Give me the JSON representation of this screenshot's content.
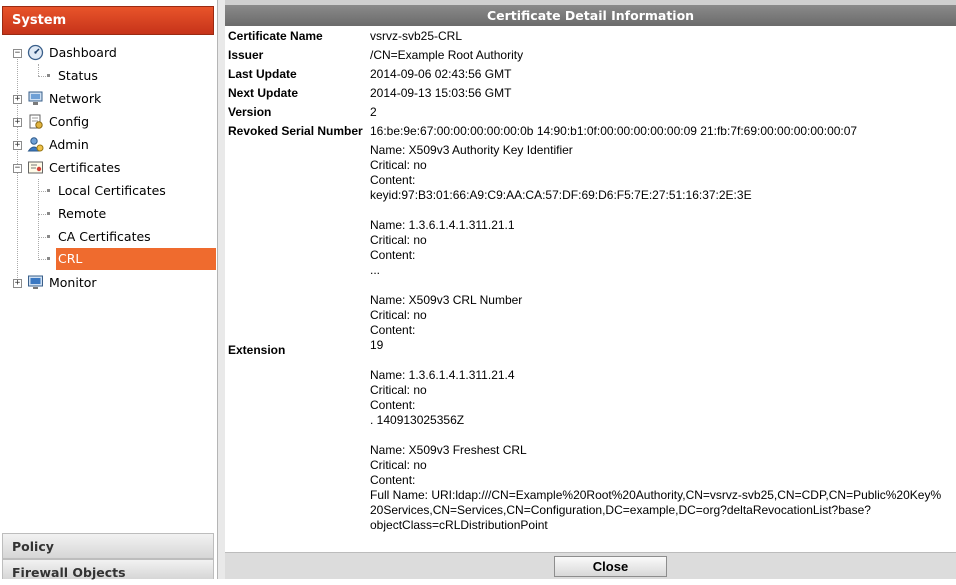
{
  "sidebar": {
    "header": "System",
    "tree": [
      {
        "label": "Dashboard",
        "icon": "dashboard-icon",
        "expanded": true
      },
      {
        "label": "Status",
        "icon": "",
        "leaf": true
      },
      {
        "label": "Network",
        "icon": "network-icon",
        "expanded": false
      },
      {
        "label": "Config",
        "icon": "config-icon",
        "expanded": false
      },
      {
        "label": "Admin",
        "icon": "admin-icon",
        "expanded": false
      },
      {
        "label": "Certificates",
        "icon": "certificates-icon",
        "expanded": true
      },
      {
        "label": "Local Certificates",
        "leaf": true
      },
      {
        "label": "Remote",
        "leaf": true
      },
      {
        "label": "CA Certificates",
        "leaf": true
      },
      {
        "label": "CRL",
        "leaf": true,
        "selected": true
      },
      {
        "label": "Monitor",
        "icon": "monitor-icon",
        "expanded": false
      }
    ],
    "bottom_sections": [
      "Policy",
      "Firewall Objects"
    ]
  },
  "panel": {
    "title": "Certificate Detail Information",
    "fields": {
      "certificate_name": {
        "label": "Certificate Name",
        "value": "vsrvz-svb25-CRL"
      },
      "issuer": {
        "label": "Issuer",
        "value": "/CN=Example Root Authority"
      },
      "last_update": {
        "label": "Last Update",
        "value": "2014-09-06 02:43:56 GMT"
      },
      "next_update": {
        "label": "Next Update",
        "value": "2014-09-13 15:03:56 GMT"
      },
      "version": {
        "label": "Version",
        "value": "2"
      },
      "revoked_serial": {
        "label": "Revoked Serial Number",
        "value": "16:be:9e:67:00:00:00:00:00:0b 14:90:b1:0f:00:00:00:00:00:09 21:fb:7f:69:00:00:00:00:00:07"
      }
    },
    "extension_label": "Extension",
    "extension_lines": [
      "Name: X509v3 Authority Key Identifier",
      "Critical: no",
      "Content:",
      "keyid:97:B3:01:66:A9:C9:AA:CA:57:DF:69:D6:F5:7E:27:51:16:37:2E:3E",
      "",
      "Name: 1.3.6.1.4.1.311.21.1",
      "Critical: no",
      "Content:",
      "...",
      "",
      "Name: X509v3 CRL Number",
      "Critical: no",
      "Content:",
      "19",
      "",
      "Name: 1.3.6.1.4.1.311.21.4",
      "Critical: no",
      "Content:",
      ". 140913025356Z",
      "",
      "Name: X509v3 Freshest CRL",
      "Critical: no",
      "Content:",
      "Full Name: URI:ldap:///CN=Example%20Root%20Authority,CN=vsrvz-svb25,CN=CDP,CN=Public%20Key%",
      "20Services,CN=Services,CN=Configuration,DC=example,DC=org?deltaRevocationList?base?",
      "objectClass=cRLDistributionPoint"
    ],
    "close_label": "Close"
  },
  "colors": {
    "accent": "#e8542a",
    "selected": "#ef6b2e",
    "title_bar": "#7a7a7a"
  }
}
